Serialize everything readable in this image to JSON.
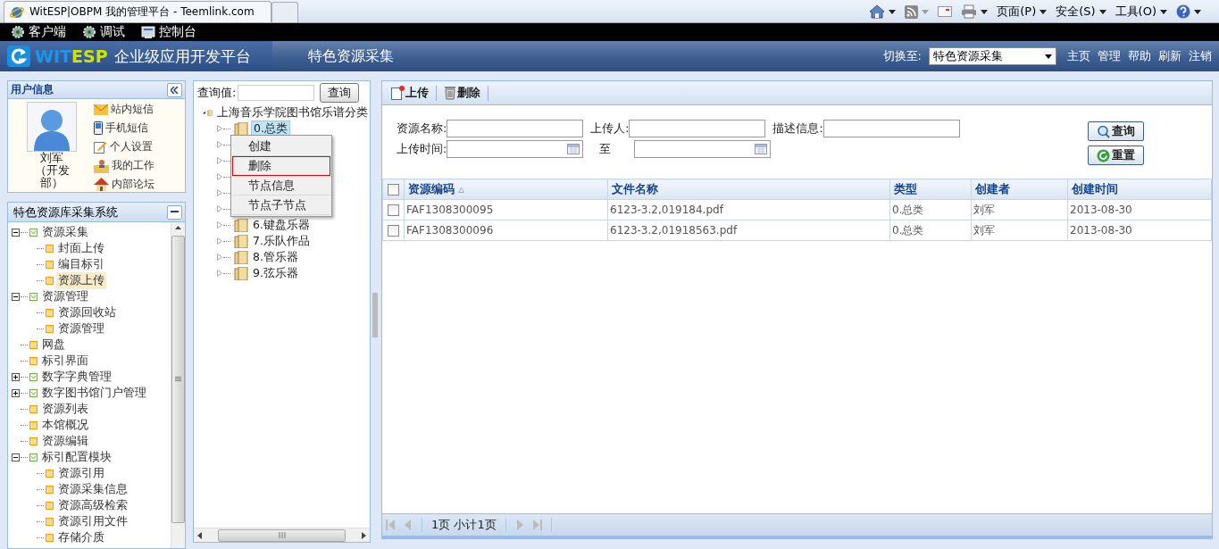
{
  "browser": {
    "tab_title": "WitESP|OBPM 我的管理平台 - Teemlink.com",
    "menus": [
      {
        "label": "页面(P)"
      },
      {
        "label": "安全(S)"
      },
      {
        "label": "工具(O)"
      }
    ]
  },
  "top_bar": {
    "items": [
      {
        "label": "客户端",
        "kind": "gear"
      },
      {
        "label": "调试",
        "kind": "gear"
      },
      {
        "label": "控制台",
        "kind": "monitor"
      }
    ]
  },
  "header": {
    "logo_part_1": "WIT",
    "logo_part_2": "ESP",
    "platform_title": "企业级应用开发平台",
    "module_title": "特色资源采集",
    "switch_label": "切换至:",
    "switch_value": "特色资源采集",
    "links": [
      "主页",
      "管理",
      "帮助",
      "刷新",
      "注销"
    ]
  },
  "user_panel": {
    "title": "用户信息",
    "user_name": "刘军（开发部）",
    "links": [
      {
        "label": "站内短信",
        "kind": "mail"
      },
      {
        "label": "手机短信",
        "kind": "phone"
      },
      {
        "label": "个人设置",
        "kind": "settings"
      },
      {
        "label": "我的工作",
        "kind": "work"
      },
      {
        "label": "内部论坛",
        "kind": "home"
      }
    ]
  },
  "nav_panel": {
    "title": "特色资源库采集系统",
    "tree": [
      {
        "label": "资源采集",
        "expanded": true,
        "children": [
          {
            "label": "封面上传",
            "selected": false
          },
          {
            "label": "编目标引",
            "selected": false
          },
          {
            "label": "资源上传",
            "selected": true
          }
        ]
      },
      {
        "label": "资源管理",
        "expanded": true,
        "children": [
          {
            "label": "资源回收站",
            "selected": false
          },
          {
            "label": "资源管理",
            "selected": false
          }
        ]
      },
      {
        "label": "网盘",
        "selected": false
      },
      {
        "label": "标引界面",
        "selected": false
      },
      {
        "label": "数字字典管理",
        "expanded": false
      },
      {
        "label": "数字图书馆门户管理",
        "expanded": false
      },
      {
        "label": "资源列表",
        "selected": false
      },
      {
        "label": "本馆概况",
        "selected": false
      },
      {
        "label": "资源编辑",
        "selected": false
      },
      {
        "label": "标引配置模块",
        "expanded": true,
        "children": [
          {
            "label": "资源引用",
            "selected": false
          },
          {
            "label": "资源采集信息",
            "selected": false
          },
          {
            "label": "资源高级检索",
            "selected": false
          },
          {
            "label": "资源引用文件",
            "selected": false
          },
          {
            "label": "存储介质",
            "selected": false
          }
        ]
      }
    ]
  },
  "category_panel": {
    "search_label": "查询值:",
    "search_button": "查询",
    "root": "上海音乐学院图书馆乐谱分类",
    "nodes": [
      {
        "kind": "node",
        "label": "0.总类",
        "selected": true
      },
      {
        "kind": "covered"
      },
      {
        "kind": "covered"
      },
      {
        "kind": "covered"
      },
      {
        "kind": "covered"
      },
      {
        "kind": "covered"
      },
      {
        "kind": "node",
        "label": "6.键盘乐器",
        "selected": false
      },
      {
        "kind": "node",
        "label": "7.乐队作品",
        "selected": false
      },
      {
        "kind": "node",
        "label": "8.管乐器",
        "selected": false
      },
      {
        "kind": "node",
        "label": "9.弦乐器",
        "selected": false
      }
    ],
    "context_menu": [
      {
        "label": "创建",
        "selected": false
      },
      {
        "label": "删除",
        "selected": true
      },
      {
        "label": "节点信息",
        "selected": false
      },
      {
        "label": "节点子节点",
        "selected": false
      }
    ]
  },
  "resource_panel": {
    "toolbar": [
      {
        "label": "上传",
        "kind": "upload"
      },
      {
        "label": "删除",
        "kind": "delete"
      }
    ],
    "form": {
      "name_label": "资源名称:",
      "uploader_label": "上传人:",
      "description_label": "描述信息:",
      "time_label": "上传时间:",
      "to_label": "至",
      "search_button": "查询",
      "reset_button": "重置"
    },
    "table": {
      "all_checked": false,
      "columns": [
        "资源编码",
        "文件名称",
        "类型",
        "创建者",
        "创建时间"
      ],
      "rows": [
        {
          "checked": false,
          "cells": [
            "FAF1308300095",
            "6123-3.2,019184.pdf",
            "0.总类",
            "刘军",
            "2013-08-30"
          ]
        },
        {
          "checked": false,
          "cells": [
            "FAF1308300096",
            "6123-3.2,01918563.pdf",
            "0.总类",
            "刘军",
            "2013-08-30"
          ]
        }
      ]
    },
    "pager": {
      "page_info": "1页 小计1页"
    }
  }
}
